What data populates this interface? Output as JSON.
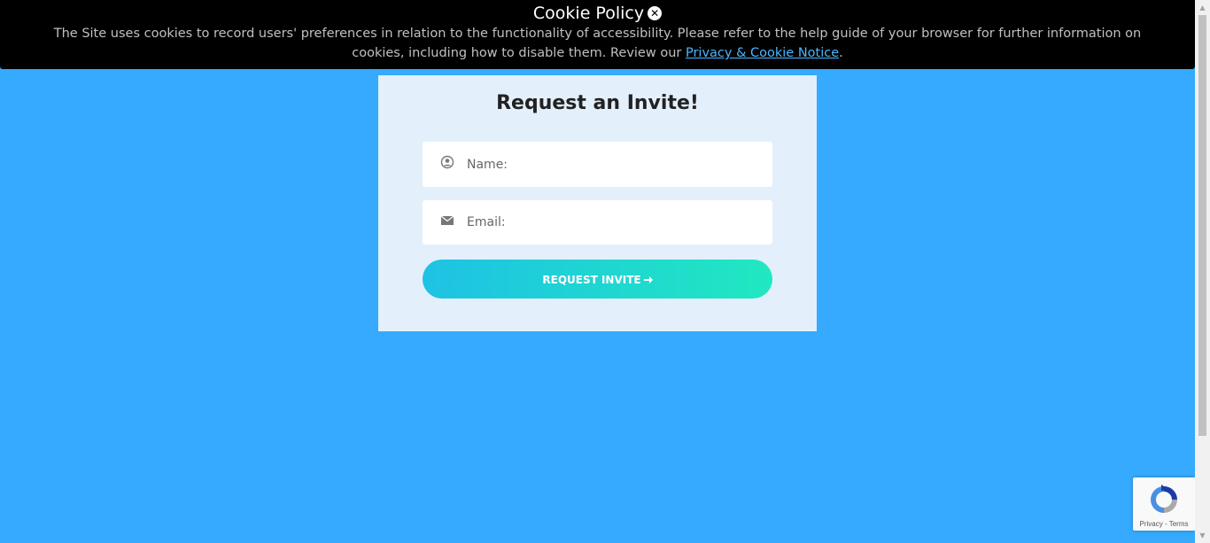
{
  "cookie_banner": {
    "title": "Cookie Policy",
    "close_icon": "close-circle-icon",
    "text_before_link": "The Site uses cookies to record users' preferences in relation to the functionality of accessibility. Please refer to the help guide of your browser for further information on cookies, including how to disable them. Review our ",
    "link_text": "Privacy & Cookie Notice",
    "text_after_link": "."
  },
  "invite_form": {
    "title": "Request an Invite!",
    "name_field": {
      "icon": "user-circle-icon",
      "placeholder": "Name:",
      "value": ""
    },
    "email_field": {
      "icon": "envelope-icon",
      "placeholder": "Email:",
      "value": ""
    },
    "submit_label": "REQUEST INVITE",
    "submit_icon": "arrow-right-icon"
  },
  "recaptcha": {
    "privacy_label": "Privacy",
    "separator": " - ",
    "terms_label": "Terms"
  },
  "colors": {
    "page_background": "#35aaff",
    "banner_background": "#000000",
    "card_background": "#e3f0fc",
    "button_gradient_start": "#1ec2e4",
    "button_gradient_end": "#20e8c0",
    "link": "#4ab7ff"
  }
}
